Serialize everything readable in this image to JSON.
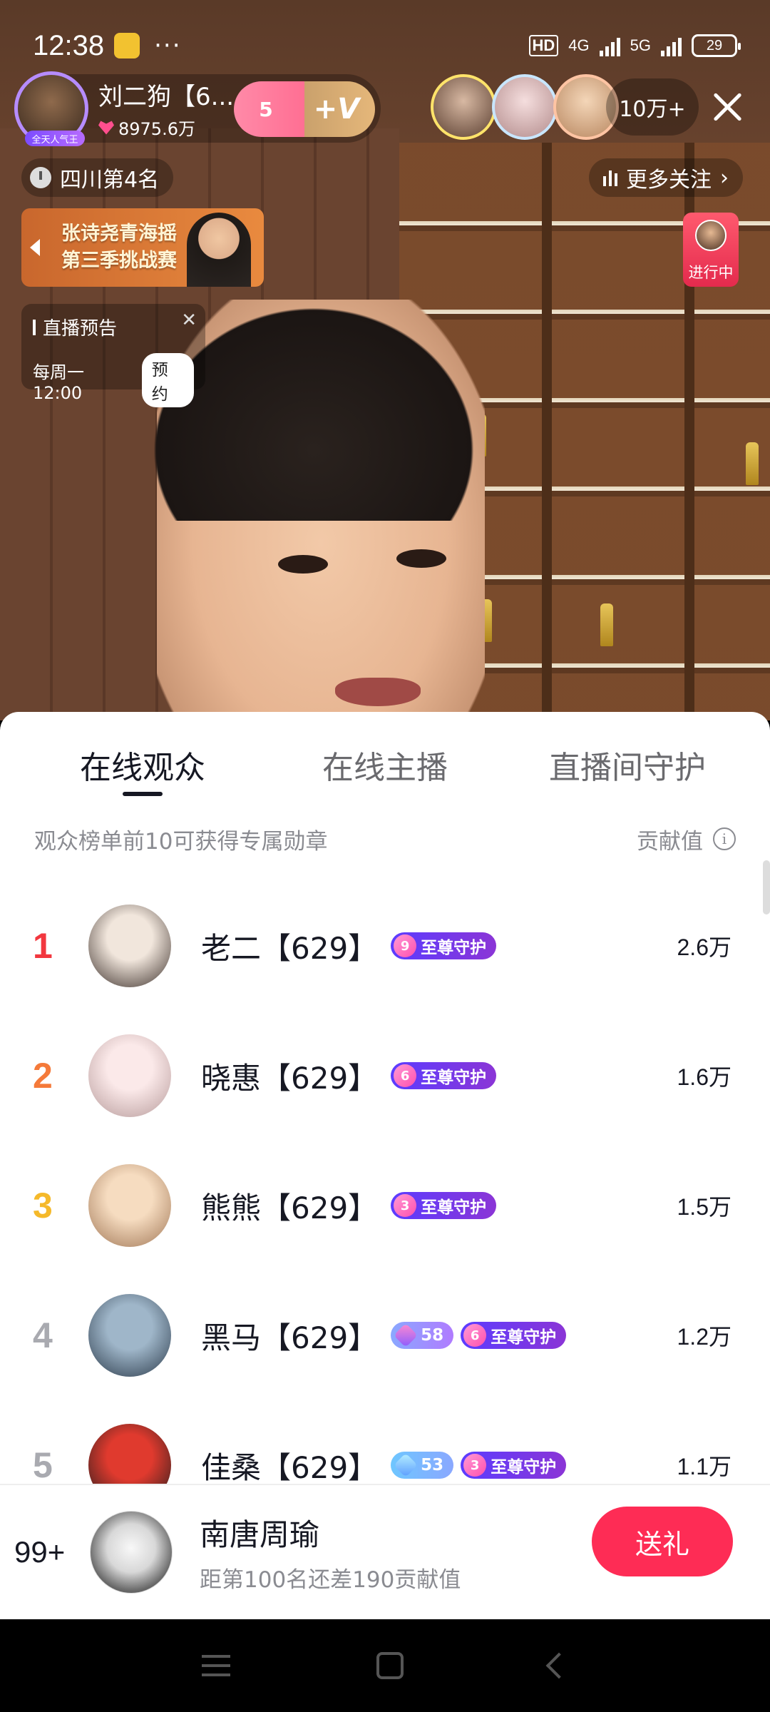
{
  "status_bar": {
    "time": "12:38",
    "more": "···",
    "hd": "HD",
    "net1": "4G",
    "net2": "5G",
    "battery": "29"
  },
  "host": {
    "name": "刘二狗【6...",
    "likes": "8975.6万",
    "avatar_badge": "全天人气王",
    "fan_level": "5",
    "fan_plus": "+V"
  },
  "viewers": {
    "count": "10万+"
  },
  "rank_pill": {
    "text": "四川第4名"
  },
  "more_follow": {
    "text": "更多关注"
  },
  "event_banner": {
    "line1": "张诗尧青海摇",
    "line2": "第三季挑战赛"
  },
  "live_now": {
    "label": "进行中"
  },
  "preview": {
    "title": "直播预告",
    "schedule": "每周一12:00",
    "reserve": "预约"
  },
  "tabs": [
    {
      "label": "在线观众",
      "active": true
    },
    {
      "label": "在线主播",
      "active": false
    },
    {
      "label": "直播间守护",
      "active": false
    }
  ],
  "sub_header": {
    "hint": "观众榜单前10可获得专属勋章",
    "value_label": "贡献值",
    "info": "i"
  },
  "ranking": [
    {
      "rank": "1",
      "name": "老二【629】",
      "fan_badge": null,
      "guard_level": "9",
      "guard_label": "至尊守护",
      "value": "2.6万",
      "rank_color": "#f2373f",
      "avatar_colors": [
        "#f1e6dc",
        "#3b2f2a"
      ]
    },
    {
      "rank": "2",
      "name": "晓惠【629】",
      "fan_badge": null,
      "guard_level": "6",
      "guard_label": "至尊守护",
      "value": "1.6万",
      "rank_color": "#f57a3a",
      "avatar_colors": [
        "#fbe9e9",
        "#b69a9a"
      ]
    },
    {
      "rank": "3",
      "name": "熊熊【629】",
      "fan_badge": null,
      "guard_level": "3",
      "guard_label": "至尊守护",
      "value": "1.5万",
      "rank_color": "#f5b92a",
      "avatar_colors": [
        "#f6dcc0",
        "#a07655"
      ]
    },
    {
      "rank": "4",
      "name": "黑马【629】",
      "fan_badge": "58",
      "guard_level": "6",
      "guard_label": "至尊守护",
      "value": "1.2万",
      "rank_color": "#a9aab0",
      "avatar_colors": [
        "#9fb6c9",
        "#2b3a4a"
      ]
    },
    {
      "rank": "5",
      "name": "佳桑【629】",
      "fan_badge": "53",
      "guard_level": "3",
      "guard_label": "至尊守护",
      "value": "1.1万",
      "rank_color": "#a9aab0",
      "avatar_colors": [
        "#e03a2e",
        "#1c1c1c"
      ]
    }
  ],
  "my_rank": {
    "rank": "99+",
    "name": "南唐周瑜",
    "sub": "距第100名还差190贡献值",
    "gift_button": "送礼"
  }
}
